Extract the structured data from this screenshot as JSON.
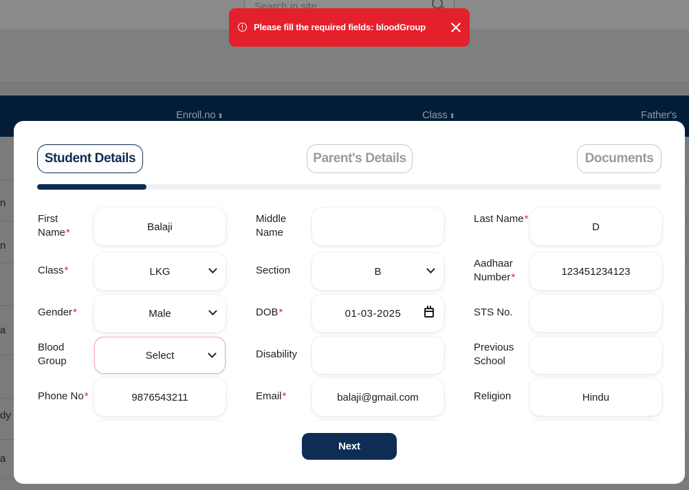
{
  "background": {
    "search_placeholder": "Search in site",
    "table_columns": [
      {
        "label": "Enroll.no"
      },
      {
        "label": "Class"
      },
      {
        "label": "Father's Na"
      }
    ],
    "row_fragments_left": [
      "n",
      "n",
      "a",
      "dy",
      "a"
    ]
  },
  "toast": {
    "message": "Please fill the required fields: bloodGroup",
    "icon": "alert-circle-icon",
    "close_icon": "close-icon",
    "color": "#e3202c"
  },
  "steps": [
    {
      "label": "Student Details",
      "active": true
    },
    {
      "label": "Parent's Details",
      "active": false
    },
    {
      "label": "Documents",
      "active": false
    }
  ],
  "progress": {
    "fraction": 0.175,
    "color": "#0d2d55"
  },
  "form": {
    "first_name": {
      "label": "First Name",
      "required": true,
      "value": "Balaji"
    },
    "middle_name": {
      "label": "Middle Name",
      "required": false,
      "value": ""
    },
    "last_name": {
      "label": "Last Name",
      "required": true,
      "value": "D"
    },
    "class": {
      "label": "Class",
      "required": true,
      "value": "LKG"
    },
    "section": {
      "label": "Section",
      "required": false,
      "value": "B"
    },
    "aadhaar": {
      "label": "Aadhaar Number",
      "required": true,
      "value": "123451234123"
    },
    "gender": {
      "label": "Gender",
      "required": true,
      "value": "Male"
    },
    "dob": {
      "label": "DOB",
      "required": true,
      "value": "01-03-2025"
    },
    "sts_no": {
      "label": "STS No.",
      "required": false,
      "value": ""
    },
    "blood_group": {
      "label": "Blood Group",
      "required": false,
      "value": "Select"
    },
    "disability": {
      "label": "Disability",
      "required": false,
      "value": ""
    },
    "previous_school": {
      "label": "Previous School",
      "required": false,
      "value": ""
    },
    "phone": {
      "label": "Phone No",
      "required": true,
      "value": "9876543211"
    },
    "email": {
      "label": "Email",
      "required": true,
      "value": "balaji@gmail.com"
    },
    "religion": {
      "label": "Religion",
      "required": false,
      "value": "Hindu"
    }
  },
  "next_label": "Next",
  "colors": {
    "primary": "#0d2d55",
    "required_star": "#e3202c",
    "error_border": "#f2a7ab"
  }
}
